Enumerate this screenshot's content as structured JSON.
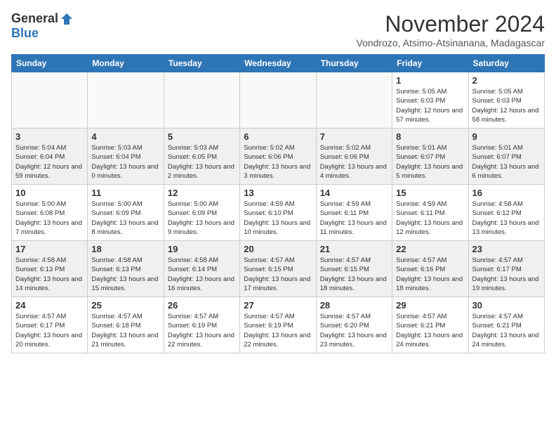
{
  "logo": {
    "general": "General",
    "blue": "Blue"
  },
  "title": "November 2024",
  "subtitle": "Vondrozo, Atsimo-Atsinanana, Madagascar",
  "days_of_week": [
    "Sunday",
    "Monday",
    "Tuesday",
    "Wednesday",
    "Thursday",
    "Friday",
    "Saturday"
  ],
  "weeks": [
    [
      {
        "day": "",
        "info": ""
      },
      {
        "day": "",
        "info": ""
      },
      {
        "day": "",
        "info": ""
      },
      {
        "day": "",
        "info": ""
      },
      {
        "day": "",
        "info": ""
      },
      {
        "day": "1",
        "info": "Sunrise: 5:05 AM\nSunset: 6:03 PM\nDaylight: 12 hours and 57 minutes."
      },
      {
        "day": "2",
        "info": "Sunrise: 5:05 AM\nSunset: 6:03 PM\nDaylight: 12 hours and 58 minutes."
      }
    ],
    [
      {
        "day": "3",
        "info": "Sunrise: 5:04 AM\nSunset: 6:04 PM\nDaylight: 12 hours and 59 minutes."
      },
      {
        "day": "4",
        "info": "Sunrise: 5:03 AM\nSunset: 6:04 PM\nDaylight: 13 hours and 0 minutes."
      },
      {
        "day": "5",
        "info": "Sunrise: 5:03 AM\nSunset: 6:05 PM\nDaylight: 13 hours and 2 minutes."
      },
      {
        "day": "6",
        "info": "Sunrise: 5:02 AM\nSunset: 6:06 PM\nDaylight: 13 hours and 3 minutes."
      },
      {
        "day": "7",
        "info": "Sunrise: 5:02 AM\nSunset: 6:06 PM\nDaylight: 13 hours and 4 minutes."
      },
      {
        "day": "8",
        "info": "Sunrise: 5:01 AM\nSunset: 6:07 PM\nDaylight: 13 hours and 5 minutes."
      },
      {
        "day": "9",
        "info": "Sunrise: 5:01 AM\nSunset: 6:07 PM\nDaylight: 13 hours and 6 minutes."
      }
    ],
    [
      {
        "day": "10",
        "info": "Sunrise: 5:00 AM\nSunset: 6:08 PM\nDaylight: 13 hours and 7 minutes."
      },
      {
        "day": "11",
        "info": "Sunrise: 5:00 AM\nSunset: 6:09 PM\nDaylight: 13 hours and 8 minutes."
      },
      {
        "day": "12",
        "info": "Sunrise: 5:00 AM\nSunset: 6:09 PM\nDaylight: 13 hours and 9 minutes."
      },
      {
        "day": "13",
        "info": "Sunrise: 4:59 AM\nSunset: 6:10 PM\nDaylight: 13 hours and 10 minutes."
      },
      {
        "day": "14",
        "info": "Sunrise: 4:59 AM\nSunset: 6:11 PM\nDaylight: 13 hours and 11 minutes."
      },
      {
        "day": "15",
        "info": "Sunrise: 4:59 AM\nSunset: 6:11 PM\nDaylight: 13 hours and 12 minutes."
      },
      {
        "day": "16",
        "info": "Sunrise: 4:58 AM\nSunset: 6:12 PM\nDaylight: 13 hours and 13 minutes."
      }
    ],
    [
      {
        "day": "17",
        "info": "Sunrise: 4:58 AM\nSunset: 6:13 PM\nDaylight: 13 hours and 14 minutes."
      },
      {
        "day": "18",
        "info": "Sunrise: 4:58 AM\nSunset: 6:13 PM\nDaylight: 13 hours and 15 minutes."
      },
      {
        "day": "19",
        "info": "Sunrise: 4:58 AM\nSunset: 6:14 PM\nDaylight: 13 hours and 16 minutes."
      },
      {
        "day": "20",
        "info": "Sunrise: 4:57 AM\nSunset: 6:15 PM\nDaylight: 13 hours and 17 minutes."
      },
      {
        "day": "21",
        "info": "Sunrise: 4:57 AM\nSunset: 6:15 PM\nDaylight: 13 hours and 18 minutes."
      },
      {
        "day": "22",
        "info": "Sunrise: 4:57 AM\nSunset: 6:16 PM\nDaylight: 13 hours and 18 minutes."
      },
      {
        "day": "23",
        "info": "Sunrise: 4:57 AM\nSunset: 6:17 PM\nDaylight: 13 hours and 19 minutes."
      }
    ],
    [
      {
        "day": "24",
        "info": "Sunrise: 4:57 AM\nSunset: 6:17 PM\nDaylight: 13 hours and 20 minutes."
      },
      {
        "day": "25",
        "info": "Sunrise: 4:57 AM\nSunset: 6:18 PM\nDaylight: 13 hours and 21 minutes."
      },
      {
        "day": "26",
        "info": "Sunrise: 4:57 AM\nSunset: 6:19 PM\nDaylight: 13 hours and 22 minutes."
      },
      {
        "day": "27",
        "info": "Sunrise: 4:57 AM\nSunset: 6:19 PM\nDaylight: 13 hours and 22 minutes."
      },
      {
        "day": "28",
        "info": "Sunrise: 4:57 AM\nSunset: 6:20 PM\nDaylight: 13 hours and 23 minutes."
      },
      {
        "day": "29",
        "info": "Sunrise: 4:57 AM\nSunset: 6:21 PM\nDaylight: 13 hours and 24 minutes."
      },
      {
        "day": "30",
        "info": "Sunrise: 4:57 AM\nSunset: 6:21 PM\nDaylight: 13 hours and 24 minutes."
      }
    ]
  ]
}
